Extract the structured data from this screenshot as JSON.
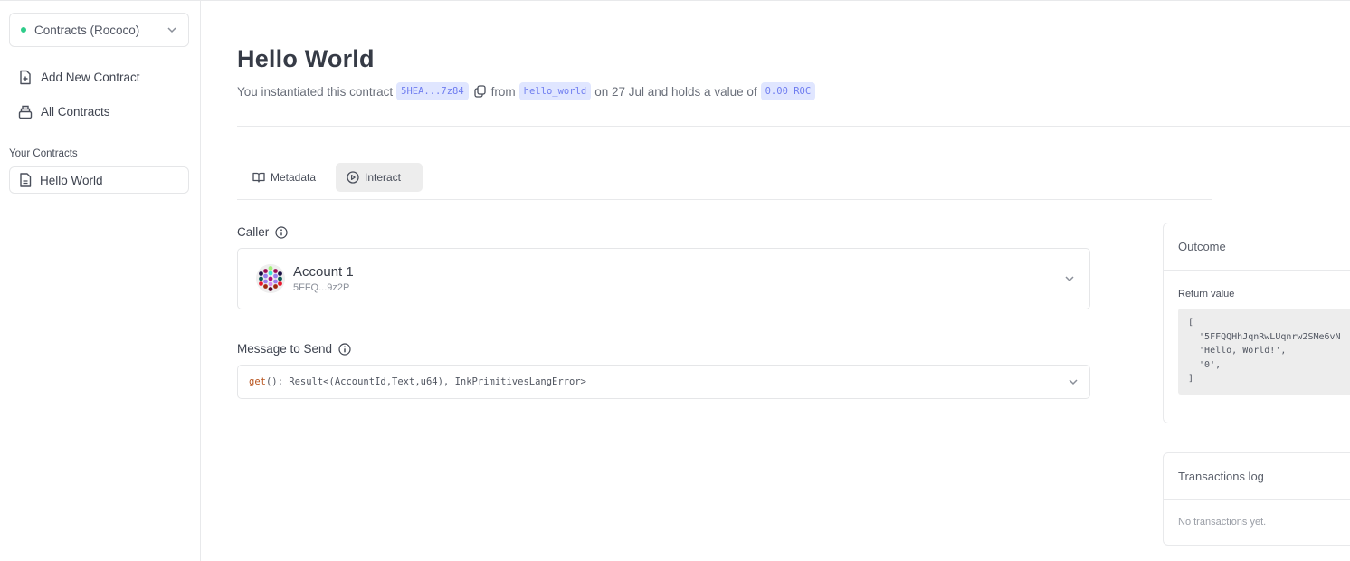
{
  "sidebar": {
    "network": {
      "label": "Contracts (Rococo)",
      "status_color": "#2ecc8a",
      "icon": "chevron-down-icon"
    },
    "nav": [
      {
        "label": "Add New Contract",
        "icon": "file-plus-icon"
      },
      {
        "label": "All Contracts",
        "icon": "collection-icon"
      }
    ],
    "section_label": "Your Contracts",
    "contracts": [
      {
        "label": "Hello World",
        "icon": "document-icon"
      }
    ]
  },
  "header": {
    "title": "Hello World",
    "subtitle": {
      "prefix": "You instantiated this contract",
      "address": "5HEA...7z84",
      "from_text": "from",
      "code_name": "hello_world",
      "date_text": "on 27 Jul and holds a value of",
      "value": "0.00 ROC"
    }
  },
  "tabs": [
    {
      "label": "Metadata",
      "icon": "book-icon",
      "active": false
    },
    {
      "label": "Interact",
      "icon": "play-circle-icon",
      "active": true
    }
  ],
  "caller": {
    "label": "Caller",
    "account_name": "Account 1",
    "account_address": "5FFQ...9z2P"
  },
  "message": {
    "label": "Message to Send",
    "fn_name": "get",
    "signature": "(): Result<(AccountId,Text,u64), InkPrimitivesLangError>"
  },
  "outcome": {
    "title": "Outcome",
    "return_label": "Return value",
    "return_value": "[\n  '5FFQQHhJqnRwLUqnrw2SMe6vN\n  'Hello, World!',\n  '0',\n]"
  },
  "transactions": {
    "title": "Transactions log",
    "empty_text": "No transactions yet."
  }
}
